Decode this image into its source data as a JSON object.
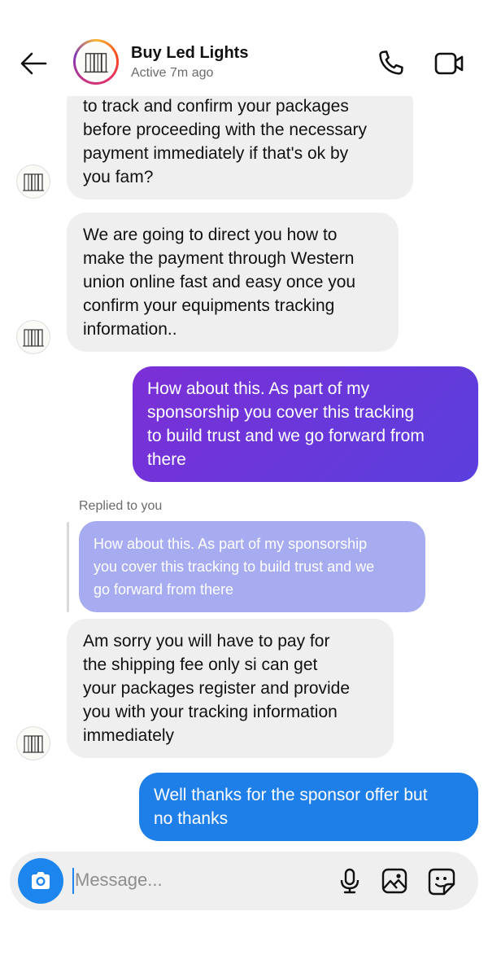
{
  "header": {
    "contact_name": "Buy Led Lights",
    "status": "Active 7m ago"
  },
  "messages": [
    {
      "direction": "incoming",
      "lines": [
        "to track and confirm your packages",
        "before proceeding with the necessary",
        "payment immediately if that's ok by",
        "you fam?"
      ]
    },
    {
      "direction": "incoming",
      "lines": [
        "We are going to direct you how to",
        "make the payment through Western",
        "union online fast and easy once you",
        "confirm your equipments tracking",
        "information.."
      ]
    },
    {
      "direction": "outgoing",
      "lines": [
        "How about this. As part of my",
        "sponsorship you cover this tracking",
        "to build trust and we go forward from",
        "there"
      ]
    },
    {
      "direction": "reply",
      "replied_label": "Replied to you",
      "quote_lines": [
        "How about this. As part of my sponsorship",
        "you cover this tracking to build trust and we",
        "go forward from there"
      ]
    },
    {
      "direction": "incoming",
      "lines": [
        "Am sorry you will have to pay for",
        "the shipping fee only si can get",
        "your packages register and provide",
        "you with your tracking information",
        "immediately"
      ]
    },
    {
      "direction": "outgoing",
      "lines": [
        "Well thanks for the sponsor offer but",
        "no thanks"
      ]
    }
  ],
  "composer": {
    "placeholder": "Message..."
  },
  "icons": {
    "back": "back-arrow-icon",
    "call": "phone-icon",
    "video": "video-camera-icon",
    "camera": "camera-icon",
    "mic": "microphone-icon",
    "gallery": "image-gallery-icon",
    "sticker": "sticker-icon"
  },
  "colors": {
    "outgoing_purple": "#6a35da",
    "outgoing_blue": "#1f7fe8",
    "incoming_bg": "#efefef",
    "reply_quote_bg": "#a6acef",
    "camera_button": "#1c86ee"
  }
}
